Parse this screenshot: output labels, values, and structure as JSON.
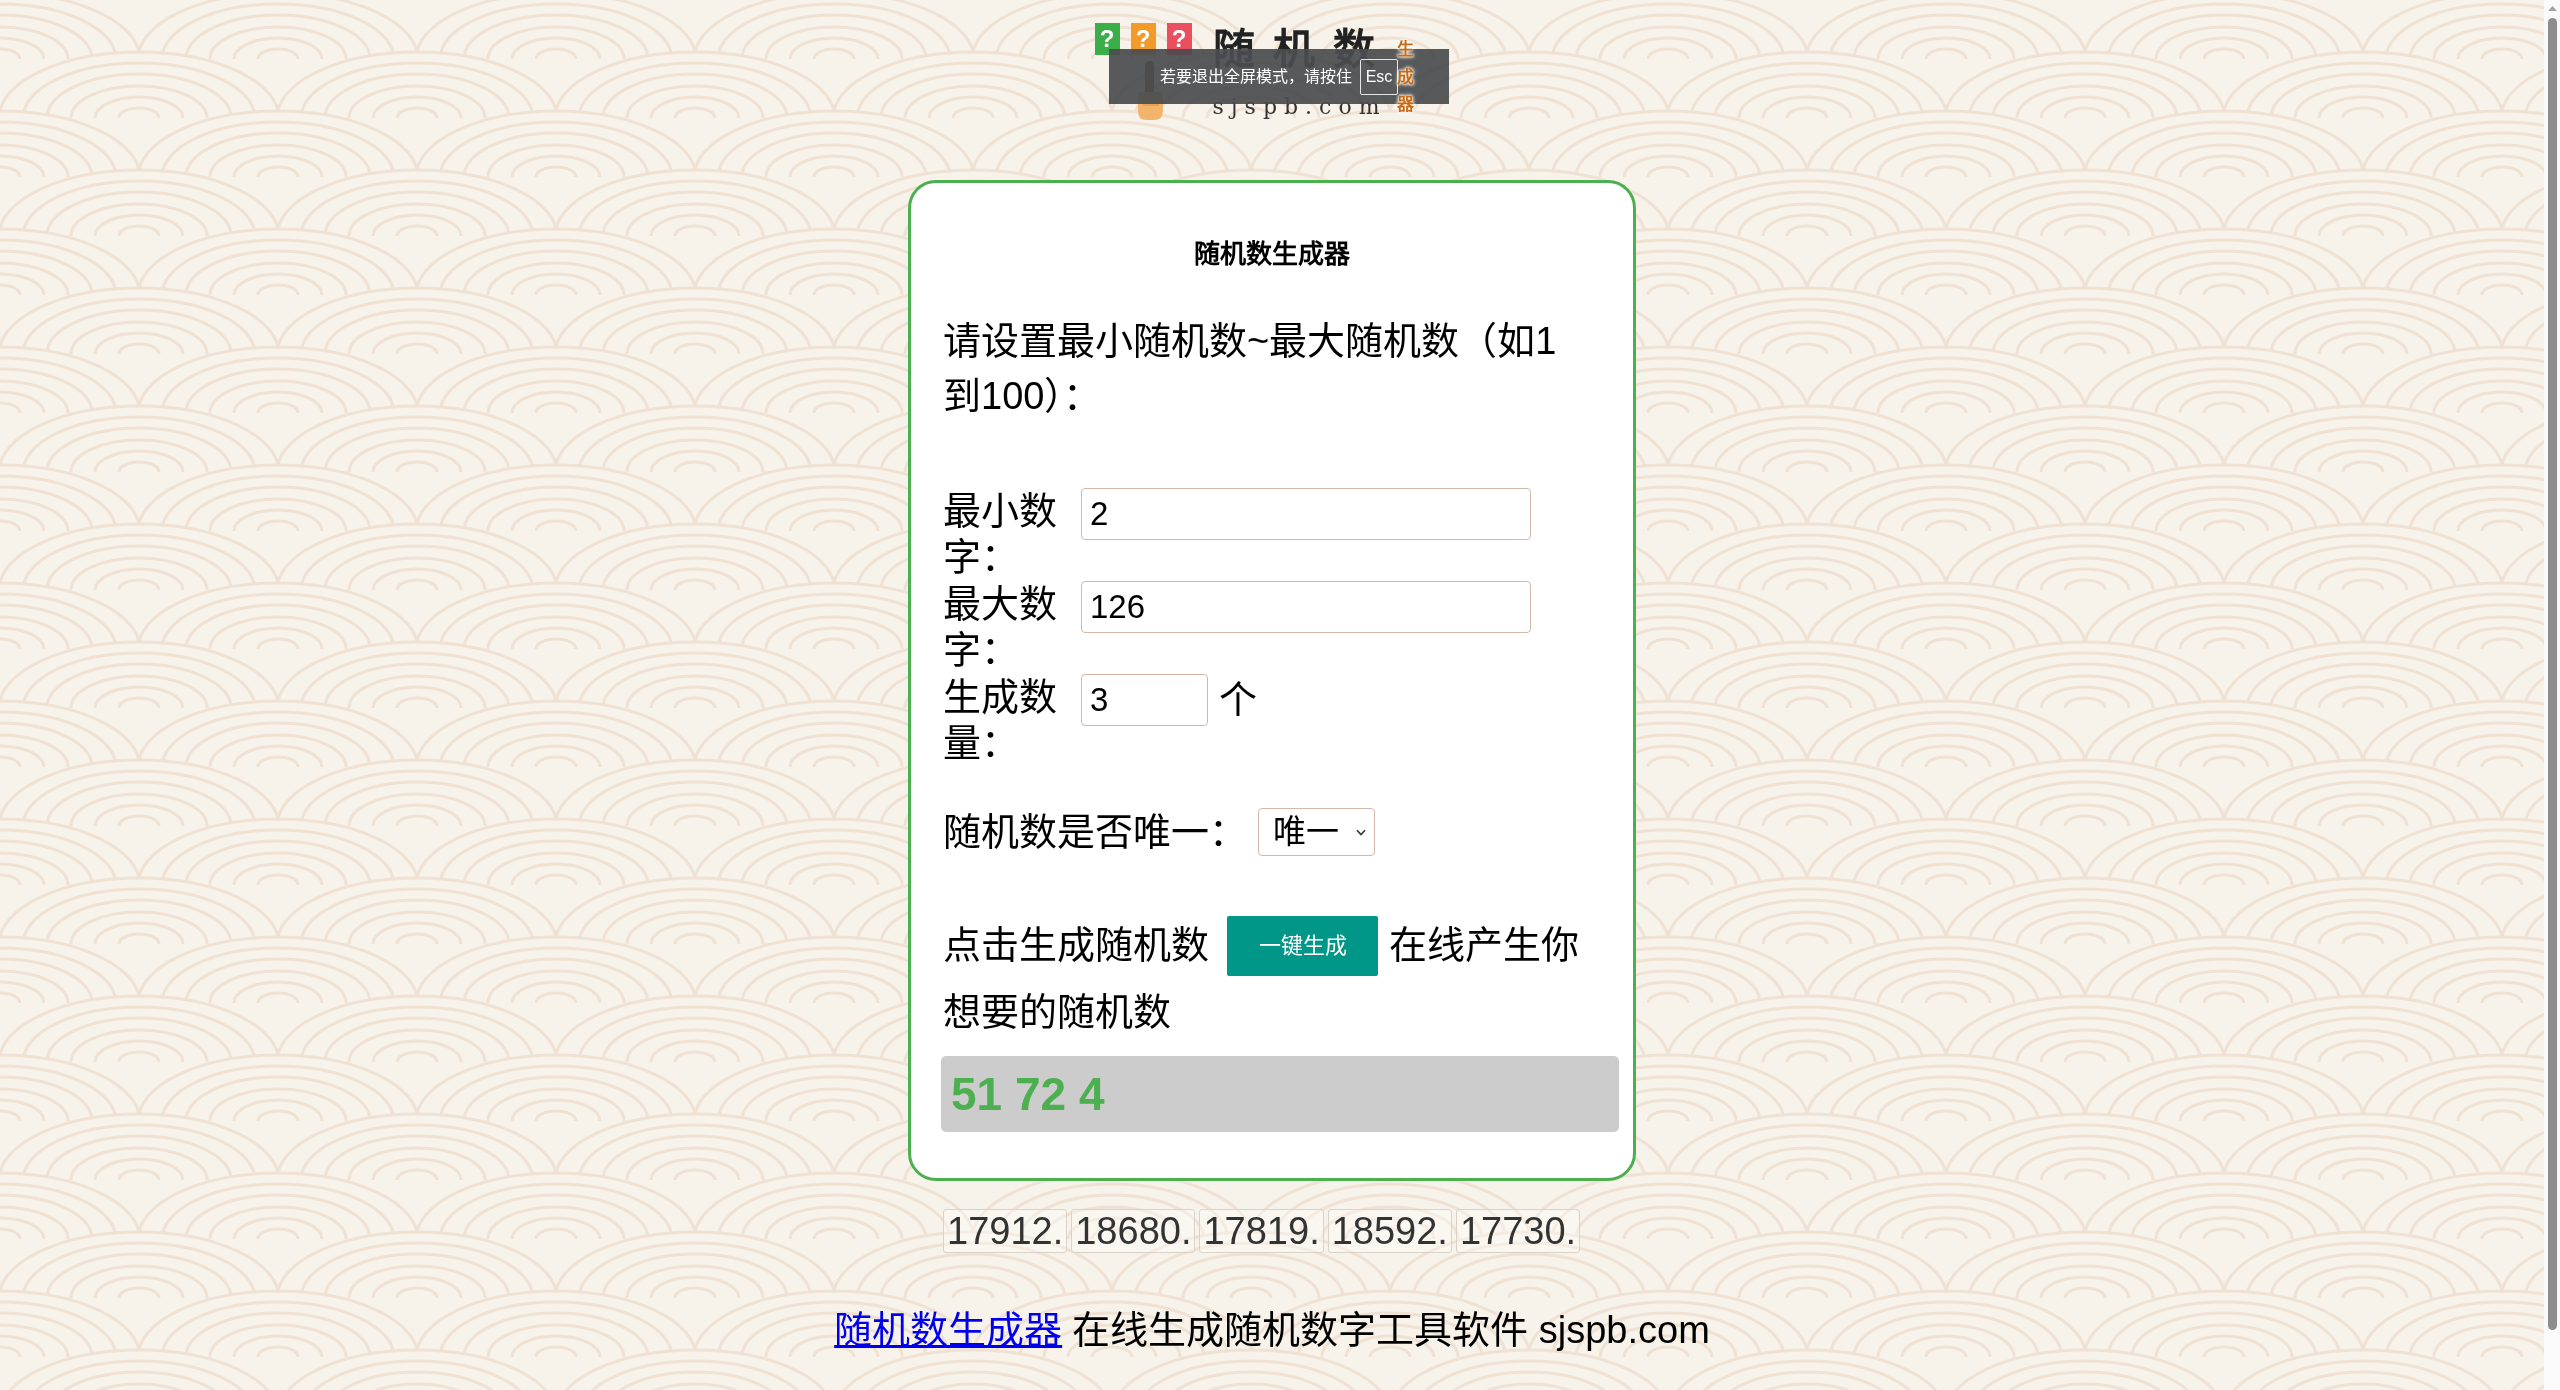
{
  "fullscreen_notice": {
    "text": "若要退出全屏模式，请按住",
    "key": "Esc"
  },
  "logo": {
    "tiles": [
      {
        "symbol": "?",
        "color": "#3bae49"
      },
      {
        "symbol": "?",
        "color": "#f29b2b"
      },
      {
        "symbol": "?",
        "color": "#e94f5e"
      }
    ],
    "title": "随机数",
    "tagline": "生成器",
    "domain": "sjspb.com"
  },
  "card": {
    "title": "随机数生成器",
    "instruction": "请设置最小随机数~最大随机数（如1到100）：",
    "fields": [
      {
        "kind": "wide",
        "label": "最小数字：",
        "value": "2"
      },
      {
        "kind": "wide",
        "label": "最大数字：",
        "value": "126"
      },
      {
        "kind": "short",
        "label": "生成数量：",
        "value": "3",
        "unit": "个"
      }
    ],
    "unique": {
      "label": "随机数是否唯一：",
      "value": "唯一"
    },
    "generate": {
      "prompt": "点击生成随机数",
      "button": "一键生成",
      "suffix": "在线产生你",
      "suffix_continued": "想要的随机数"
    },
    "result": "51 72 4"
  },
  "history": [
    "17912.",
    "18680.",
    "17819.",
    "18592.",
    "17730."
  ],
  "footer": {
    "link": "随机数生成器",
    "text": "在线生成随机数字工具软件 sjspb.com"
  }
}
